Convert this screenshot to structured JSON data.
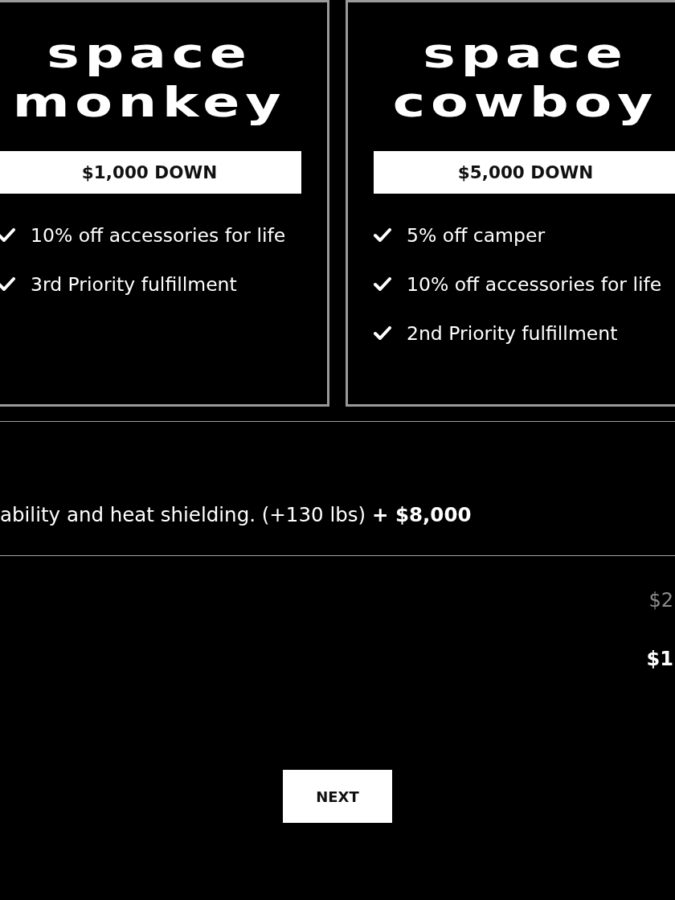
{
  "plans": [
    {
      "name": "space monkey",
      "deposit": "$1,000 DOWN",
      "perks": [
        "10% off accessories for life",
        "3rd Priority fulfillment"
      ]
    },
    {
      "name": "space cowboy",
      "deposit": "$5,000 DOWN",
      "perks": [
        "5% off camper",
        "10% off accessories for life",
        "2nd Priority fulfillment"
      ]
    }
  ],
  "option": {
    "description": "ability and heat shielding. (+130 lbs) **+ $8,000**"
  },
  "summary": [
    {
      "kind": "muted",
      "text": "$2"
    },
    {
      "kind": "total",
      "text": "$1"
    }
  ],
  "next_button": "NEXT"
}
